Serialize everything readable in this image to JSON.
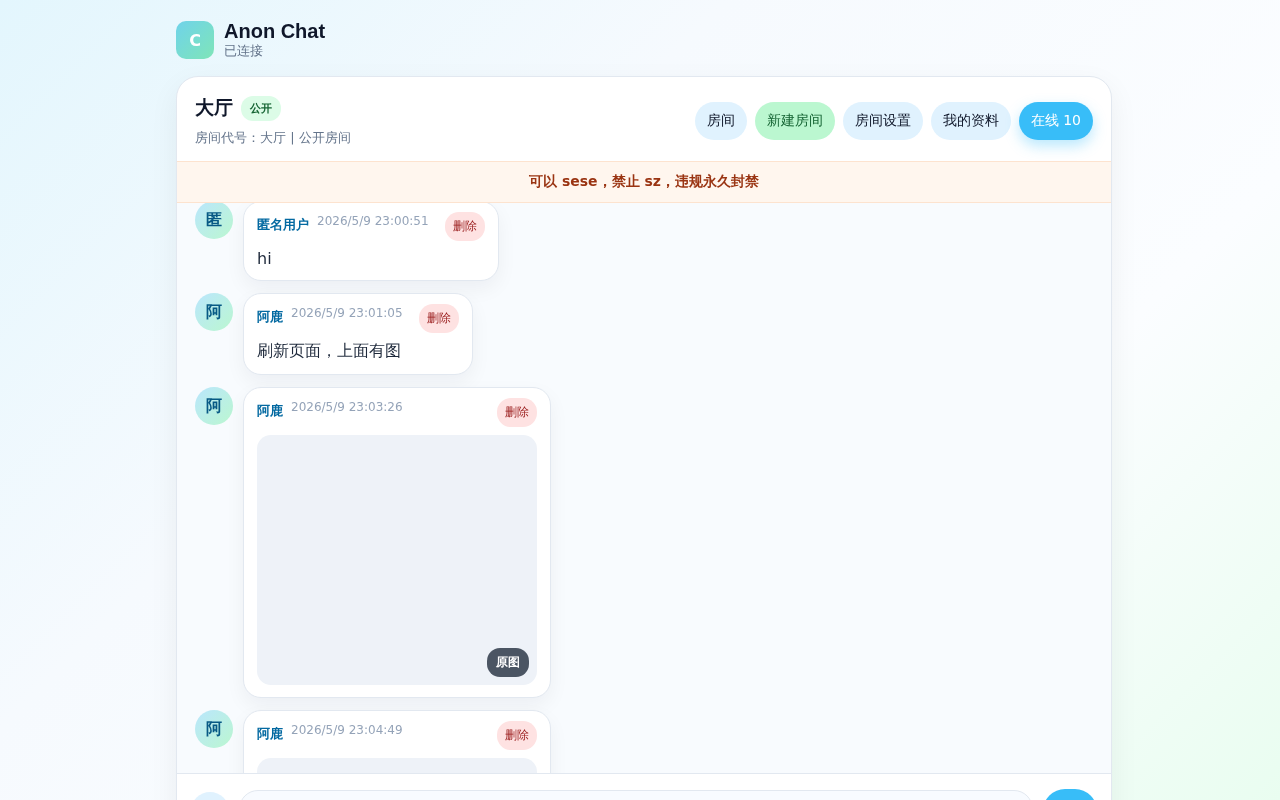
{
  "app": {
    "logo": "C",
    "title": "Anon Chat",
    "status": "已连接"
  },
  "room": {
    "name": "大厅",
    "badge": "公开",
    "info": "房间代号：大厅 | 公开房间"
  },
  "actions": [
    {
      "label": "房间",
      "kind": "plain"
    },
    {
      "label": "新建房间",
      "kind": "create"
    },
    {
      "label": "房间设置",
      "kind": "plain"
    },
    {
      "label": "我的资料",
      "kind": "plain"
    },
    {
      "label": "在线 10",
      "kind": "online"
    }
  ],
  "notice": "可以 sese，禁止 sz，违规永久封禁",
  "messages": [
    {
      "avatar": "匿",
      "name": "匿名用户",
      "time": "2026/5/9 23:00:51",
      "delete": "删除",
      "kind": "text",
      "text": "hi"
    },
    {
      "avatar": "阿",
      "name": "阿鹿",
      "time": "2026/5/9 23:01:05",
      "delete": "删除",
      "kind": "text",
      "text": "刷新页面，上面有图"
    },
    {
      "avatar": "阿",
      "name": "阿鹿",
      "time": "2026/5/9 23:03:26",
      "delete": "删除",
      "kind": "image",
      "image_button": "原图"
    },
    {
      "avatar": "阿",
      "name": "阿鹿",
      "time": "2026/5/9 23:04:49",
      "delete": "删除",
      "kind": "image_cut"
    }
  ]
}
